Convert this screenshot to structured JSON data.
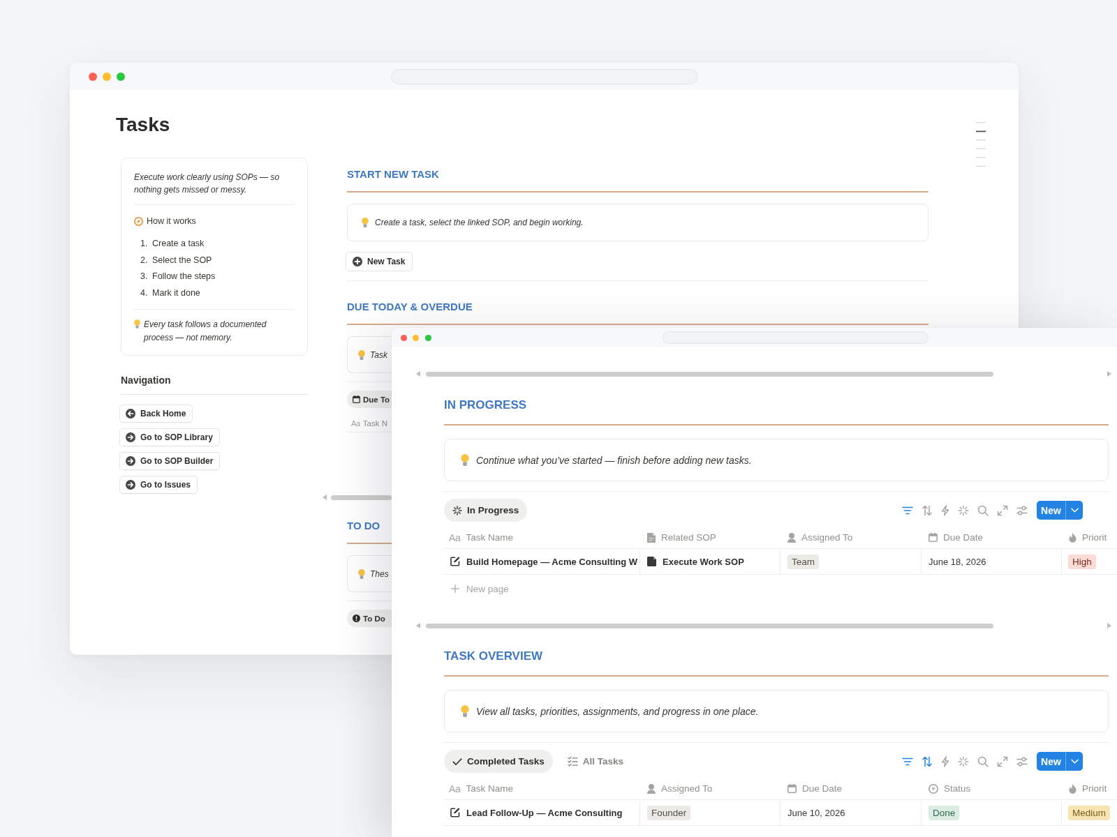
{
  "back_window": {
    "page_title": "Tasks",
    "intro_card": {
      "tagline": "Execute work clearly using SOPs — so nothing gets missed or messy.",
      "how_heading": "How it works",
      "steps": [
        {
          "number": "1.",
          "text": "Create a task"
        },
        {
          "number": "2.",
          "text": "Select the SOP"
        },
        {
          "number": "3.",
          "text": "Follow the steps"
        },
        {
          "number": "4.",
          "text": "Mark it done"
        }
      ],
      "note": "Every task follows a documented process — not memory."
    },
    "navigation": {
      "heading": "Navigation",
      "links": [
        {
          "label": "Back Home",
          "kind": "back"
        },
        {
          "label": "Go to SOP Library",
          "kind": "forward"
        },
        {
          "label": "Go to SOP Builder",
          "kind": "forward"
        },
        {
          "label": "Go to Issues",
          "kind": "forward"
        }
      ]
    },
    "sections": [
      {
        "heading": "START NEW TASK",
        "callout": "Create a task, select the linked SOP, and begin working.",
        "button": "New Task"
      },
      {
        "heading": "DUE TODAY & OVERDUE",
        "callout": "Task",
        "views": [
          {
            "label": "Due To",
            "kind": "due",
            "selected": true
          }
        ],
        "columns": [
          {
            "label": "Task N",
            "kind": "title",
            "glyph": "Aa"
          }
        ]
      },
      {
        "heading": "TO DO",
        "callout": "Thes",
        "views": [
          {
            "label": "To Do",
            "kind": "todo",
            "selected": true
          }
        ]
      }
    ]
  },
  "front_window": {
    "sections": [
      {
        "heading": "IN PROGRESS",
        "callout": "Continue what you’ve started — finish before adding new tasks.",
        "views": [
          {
            "label": "In Progress",
            "kind": "progress",
            "selected": true
          }
        ],
        "filter_active": true,
        "sort_active": false,
        "new_button": "New",
        "columns": [
          {
            "label": "Task Name",
            "kind": "title",
            "glyph": "Aa"
          },
          {
            "label": "Related SOP",
            "kind": "relation"
          },
          {
            "label": "Assigned To",
            "kind": "person"
          },
          {
            "label": "Due Date",
            "kind": "date"
          },
          {
            "label": "Priorit",
            "kind": "priority"
          }
        ],
        "rows": [
          {
            "cells": [
              {
                "text": "Build Homepage — Acme Consulting W"
              },
              {
                "text": "Execute Work SOP"
              },
              {
                "text": "Team",
                "color": "#ebeae7"
              },
              {
                "text": "June 18, 2026"
              },
              {
                "text": "High",
                "color": "#fadbd6"
              }
            ]
          }
        ],
        "add_row": "New page"
      },
      {
        "heading": "TASK OVERVIEW",
        "callout": "View all tasks, priorities, assignments, and progress in one place.",
        "views": [
          {
            "label": "Completed Tasks",
            "kind": "done",
            "selected": true
          },
          {
            "label": "All Tasks",
            "kind": "all",
            "selected": false
          }
        ],
        "filter_active": true,
        "sort_active": true,
        "new_button": "New",
        "columns": [
          {
            "label": "Task Name",
            "kind": "title",
            "glyph": "Aa"
          },
          {
            "label": "Assigned To",
            "kind": "person"
          },
          {
            "label": "Due Date",
            "kind": "date"
          },
          {
            "label": "Status",
            "kind": "status"
          },
          {
            "label": "Priorit",
            "kind": "priority"
          }
        ],
        "rows": [
          {
            "cells": [
              {
                "text": "Lead Follow-Up — Acme Consulting"
              },
              {
                "text": "Founder",
                "color": "#ebeae7"
              },
              {
                "text": "June 10, 2026"
              },
              {
                "text": "Done",
                "color": "#dbece2"
              },
              {
                "text": "Medium",
                "color": "#f7e4b3"
              }
            ]
          }
        ]
      }
    ]
  }
}
